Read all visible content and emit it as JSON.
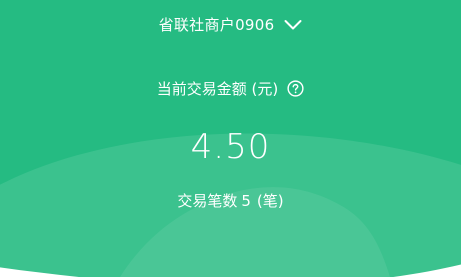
{
  "merchant": {
    "name": "省联社商户0906"
  },
  "summary": {
    "amount_label": "当前交易金额 (元)",
    "amount_value": "4.50",
    "count_label": "交易笔数",
    "count_value": "5",
    "count_unit": "(笔)"
  },
  "icons": {
    "merchant_dropdown": "chevron-down-icon",
    "amount_help": "question-circle-icon"
  },
  "colors": {
    "primary_green": "#25bb82",
    "text": "#ffffff"
  }
}
